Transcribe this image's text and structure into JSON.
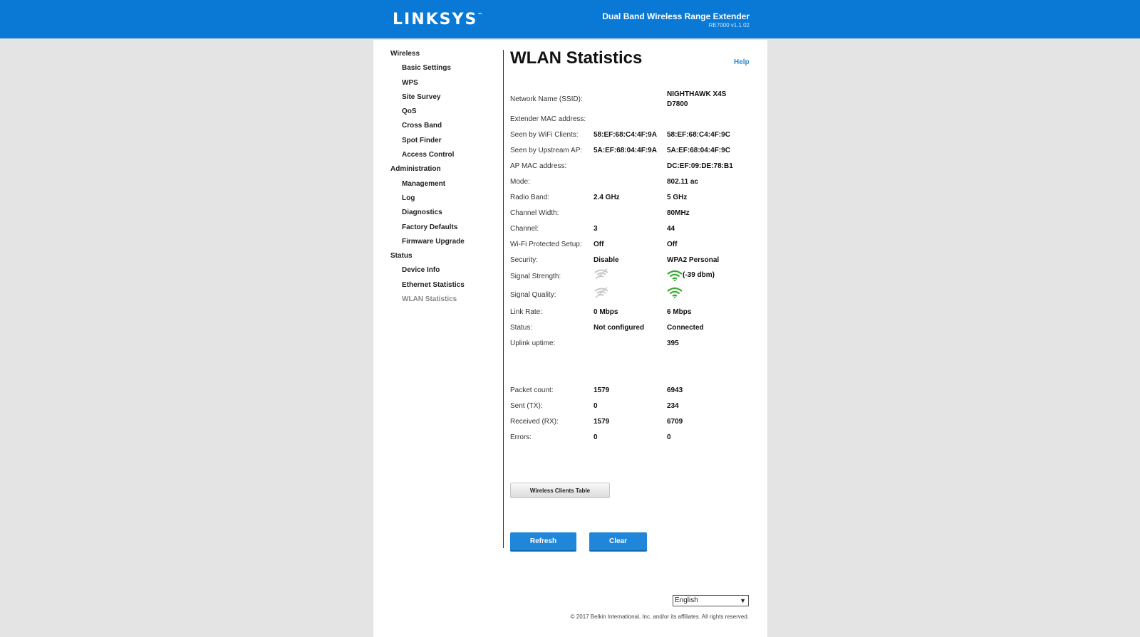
{
  "header": {
    "logo": "LINKSYS",
    "logo_mark": "™",
    "product": "Dual Band Wireless Range Extender",
    "model": "RE7000 v1.1.02"
  },
  "sidebar": {
    "sections": [
      {
        "label": "Wireless",
        "items": [
          "Basic Settings",
          "WPS",
          "Site Survey",
          "QoS",
          "Cross Band",
          "Spot Finder",
          "Access Control"
        ]
      },
      {
        "label": "Administration",
        "items": [
          "Management",
          "Log",
          "Diagnostics",
          "Factory Defaults",
          "Firmware Upgrade"
        ]
      },
      {
        "label": "Status",
        "items": [
          "Device Info",
          "Ethernet Statistics",
          "WLAN Statistics"
        ]
      }
    ],
    "active": "WLAN Statistics"
  },
  "main": {
    "title": "WLAN Statistics",
    "help": "Help",
    "ssid": {
      "label": "Network Name (SSID):",
      "value": "NIGHTHAWK X4S D7800"
    },
    "rows": [
      {
        "label": "Extender MAC address:",
        "v1": "",
        "v2": ""
      },
      {
        "label": "Seen by WiFi Clients:",
        "v1": "58:EF:68:C4:4F:9A",
        "v2": "58:EF:68:C4:4F:9C"
      },
      {
        "label": "Seen by Upstream AP:",
        "v1": "5A:EF:68:04:4F:9A",
        "v2": "5A:EF:68:04:4F:9C"
      },
      {
        "label": "AP MAC address:",
        "v1": "",
        "v2": "DC:EF:09:DE:78:B1"
      },
      {
        "label": "Mode:",
        "v1": "",
        "v2": "802.11 ac"
      },
      {
        "label": "Radio Band:",
        "v1": "2.4 GHz",
        "v2": "5 GHz"
      },
      {
        "label": "Channel Width:",
        "v1": "",
        "v2": "80MHz"
      },
      {
        "label": "Channel:",
        "v1": "3",
        "v2": "44"
      },
      {
        "label": "Wi-Fi Protected Setup:",
        "v1": "Off",
        "v2": "Off"
      },
      {
        "label": "Security:",
        "v1": "Disable",
        "v2": "WPA2 Personal"
      }
    ],
    "signal_strength": {
      "label": "Signal Strength:",
      "v2_text": "(-39 dbm)"
    },
    "signal_quality": {
      "label": "Signal Quality:"
    },
    "rows2": [
      {
        "label": "Link Rate:",
        "v1": "0 Mbps",
        "v2": "6 Mbps"
      },
      {
        "label": "Status:",
        "v1": "Not configured",
        "v2": "Connected"
      },
      {
        "label": "Uplink uptime:",
        "v1": "",
        "v2": "395"
      }
    ],
    "packets": [
      {
        "label": "Packet count:",
        "v1": "1579",
        "v2": "6943"
      },
      {
        "label": "Sent (TX):",
        "v1": "0",
        "v2": "234"
      },
      {
        "label": "Received (RX):",
        "v1": "1579",
        "v2": "6709"
      },
      {
        "label": "Errors:",
        "v1": "0",
        "v2": "0"
      }
    ],
    "clients_table_button": "Wireless Clients Table",
    "refresh_button": "Refresh",
    "clear_button": "Clear"
  },
  "footer": {
    "language": "English",
    "copyright": "© 2017 Belkin International, Inc. and/or its affiliates. All rights reserved."
  },
  "colors": {
    "brand_blue": "#0a79d6",
    "signal_green": "#3aaa35",
    "signal_gray": "#c8c8c8"
  }
}
